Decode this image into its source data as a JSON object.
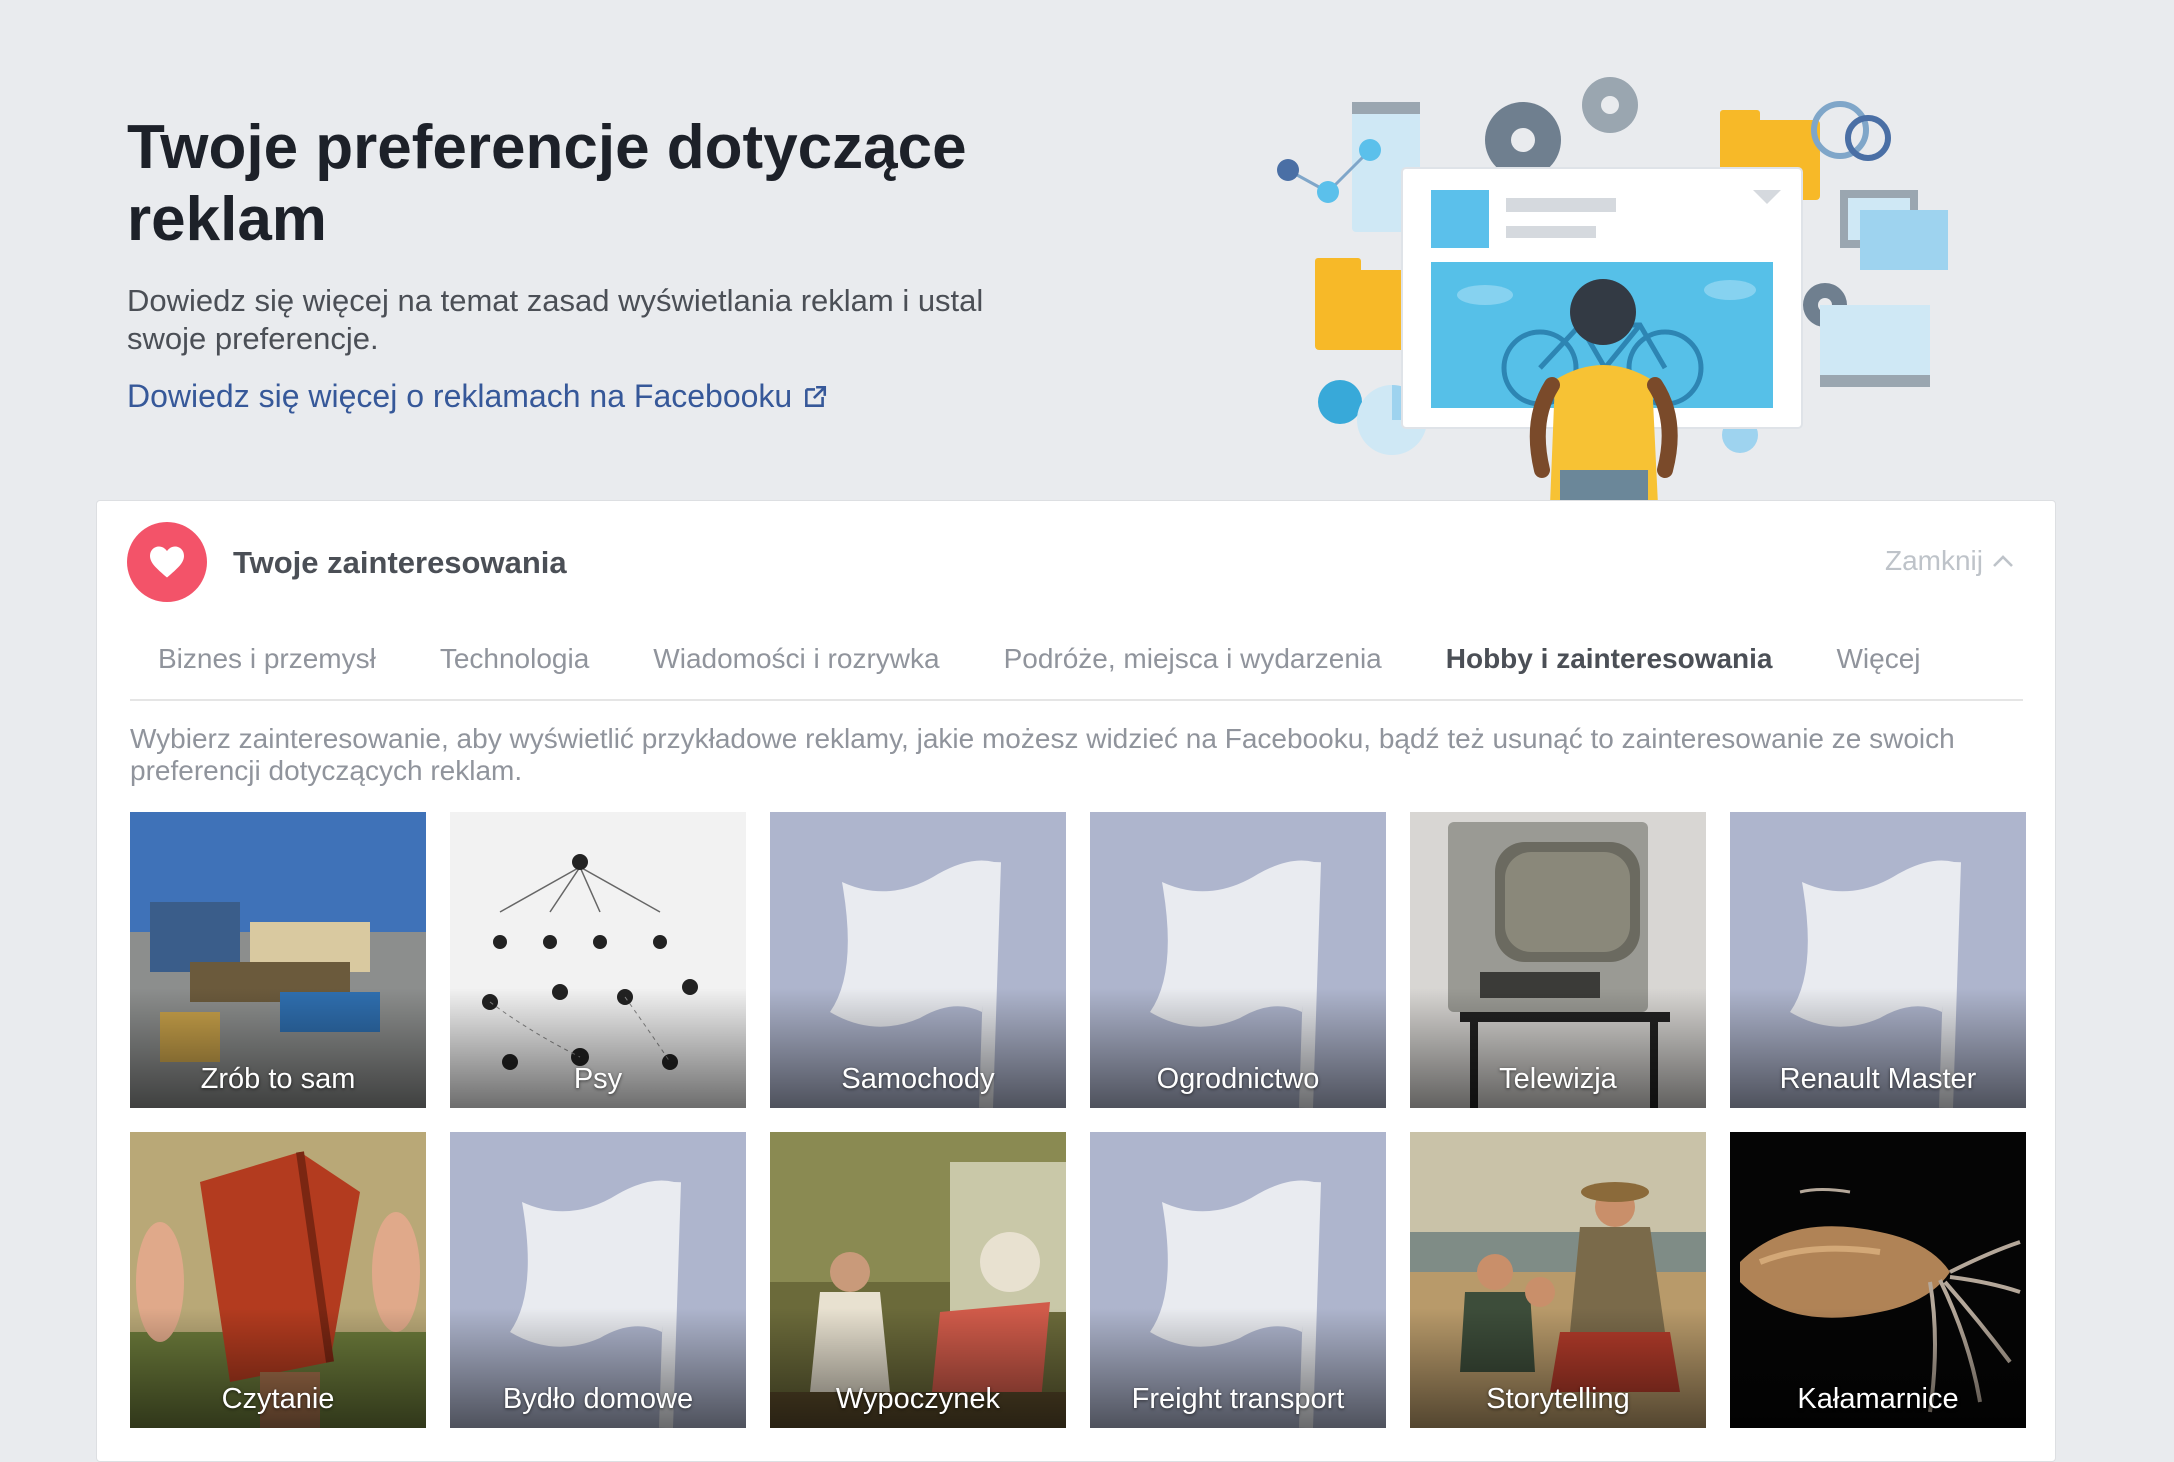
{
  "hero": {
    "title": "Twoje preferencje dotyczące reklam",
    "subtitle": "Dowiedz się więcej na temat zasad wyświetlania reklam i ustal swoje preferencje.",
    "link": "Dowiedz się więcej o reklamach na Facebooku",
    "link_icon": "external-link-icon"
  },
  "panel": {
    "title": "Twoje zainteresowania",
    "icon": "heart-icon",
    "close_label": "Zamknij",
    "tabs": [
      {
        "label": "Biznes i przemysł"
      },
      {
        "label": "Technologia"
      },
      {
        "label": "Wiadomości i rozrywka"
      },
      {
        "label": "Podróże, miejsca i wydarzenia"
      },
      {
        "label": "Hobby i zainteresowania",
        "active": true
      },
      {
        "label": "Więcej"
      }
    ],
    "description": "Wybierz zainteresowanie, aby wyświetlić przykładowe reklamy, jakie możesz widzieć na Facebooku, bądź też usunąć to zainteresowanie ze swoich preferencji dotyczących reklam.",
    "interests": [
      {
        "label": "Zrób to sam",
        "image": "photo"
      },
      {
        "label": "Psy",
        "image": "photo"
      },
      {
        "label": "Samochody",
        "image": "flag-placeholder"
      },
      {
        "label": "Ogrodnictwo",
        "image": "flag-placeholder"
      },
      {
        "label": "Telewizja",
        "image": "photo"
      },
      {
        "label": "Renault Master",
        "image": "flag-placeholder"
      },
      {
        "label": "Czytanie",
        "image": "photo"
      },
      {
        "label": "Bydło domowe",
        "image": "flag-placeholder"
      },
      {
        "label": "Wypoczynek",
        "image": "photo"
      },
      {
        "label": "Freight transport",
        "image": "flag-placeholder"
      },
      {
        "label": "Storytelling",
        "image": "photo"
      },
      {
        "label": "Kałamarnice",
        "image": "photo"
      }
    ]
  },
  "colors": {
    "link": "#365899",
    "heart_badge": "#f35369",
    "placeholder_tile": "#aeb5cd",
    "background": "#e9ebee"
  }
}
